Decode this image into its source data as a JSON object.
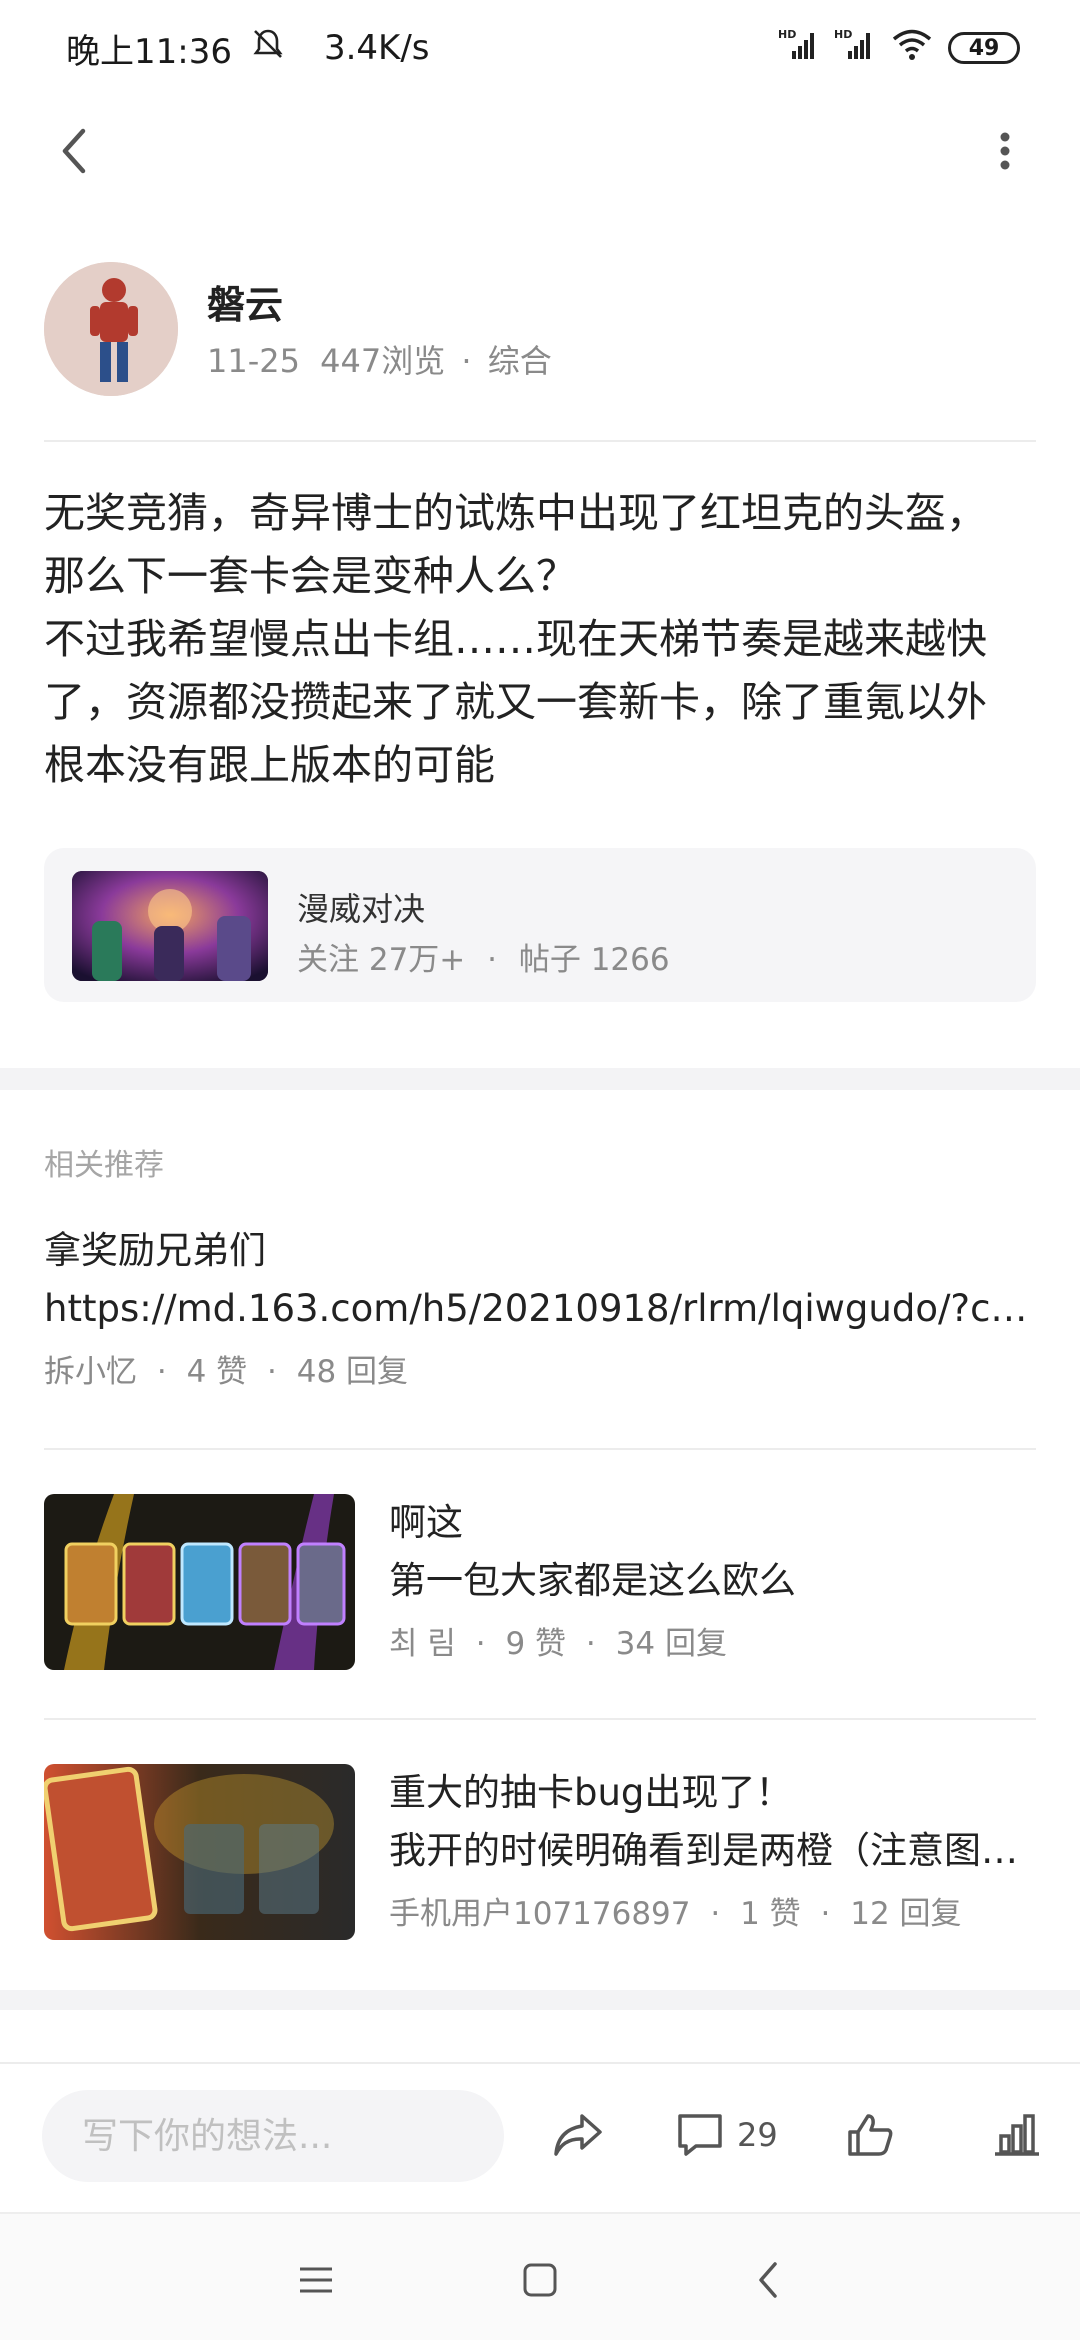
{
  "status": {
    "time": "晚上11:36",
    "speed": "3.4K/s",
    "battery": "49",
    "signal_label": "HD"
  },
  "author": {
    "name": "磐云",
    "date": "11-25",
    "views": "447浏览",
    "category": "综合"
  },
  "post": {
    "line1": "无奖竞猜，奇异博士的试炼中出现了红坦克的头盔，",
    "line2": "那么下一套卡会是变种人么？",
    "line3": "不过我希望慢点出卡组……现在天梯节奏是越来越快",
    "line4": "了，资源都没攒起来了就又一套新卡，除了重氪以外",
    "line5": "根本没有跟上版本的可能"
  },
  "topic": {
    "name": "漫威对决",
    "followers": "关注 27万+",
    "posts": "帖子 1266"
  },
  "recommend": {
    "title": "相关推荐",
    "items": [
      {
        "title": "拿奖励兄弟们",
        "subtitle": "https://md.163.com/h5/20210918/rlrm/lqiwgudo/?cha…",
        "author": "拆小忆",
        "likes": "4 赞",
        "replies": "48 回复"
      },
      {
        "title": "啊这",
        "subtitle": "第一包大家都是这么欧么",
        "author": "최 림",
        "likes": "9 赞",
        "replies": "34 回复"
      },
      {
        "title": "重大的抽卡bug出现了！",
        "subtitle": "我开的时候明确看到是两橙（注意图…",
        "author": "手机用户107176897",
        "likes": "1 赞",
        "replies": "12 回复"
      }
    ]
  },
  "bottom_bar": {
    "input_placeholder": "写下你的想法...",
    "comment_count": "29"
  },
  "colors": {
    "text": "#222222",
    "meta": "#8a8a8a",
    "card_bg": "#f5f5f7"
  }
}
